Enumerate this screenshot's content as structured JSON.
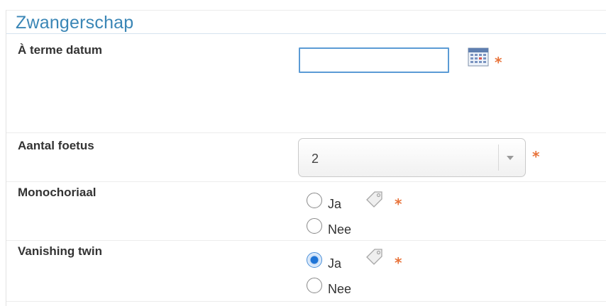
{
  "section": {
    "title": "Zwangerschap"
  },
  "fields": {
    "due_date": {
      "label": "À terme datum",
      "value": "",
      "required_mark": "*"
    },
    "fetus_count": {
      "label": "Aantal foetus",
      "selected": "2",
      "required_mark": "*"
    },
    "monochorial": {
      "label": "Monochoriaal",
      "options": [
        {
          "label": "Ja",
          "checked": false
        },
        {
          "label": "Nee",
          "checked": false
        }
      ],
      "required_mark": "*"
    },
    "vanishing_twin": {
      "label": "Vanishing twin",
      "options": [
        {
          "label": "Ja",
          "checked": true
        },
        {
          "label": "Nee",
          "checked": false
        }
      ],
      "required_mark": "*"
    }
  },
  "icons": {
    "calendar": "calendar-icon",
    "tag": "tag-icon",
    "dropdown": "chevron-down-icon"
  },
  "colors": {
    "title": "#3a86b6",
    "required": "#e8733a",
    "focus_border": "#5b9bd5",
    "radio_checked": "#1f74d6"
  }
}
